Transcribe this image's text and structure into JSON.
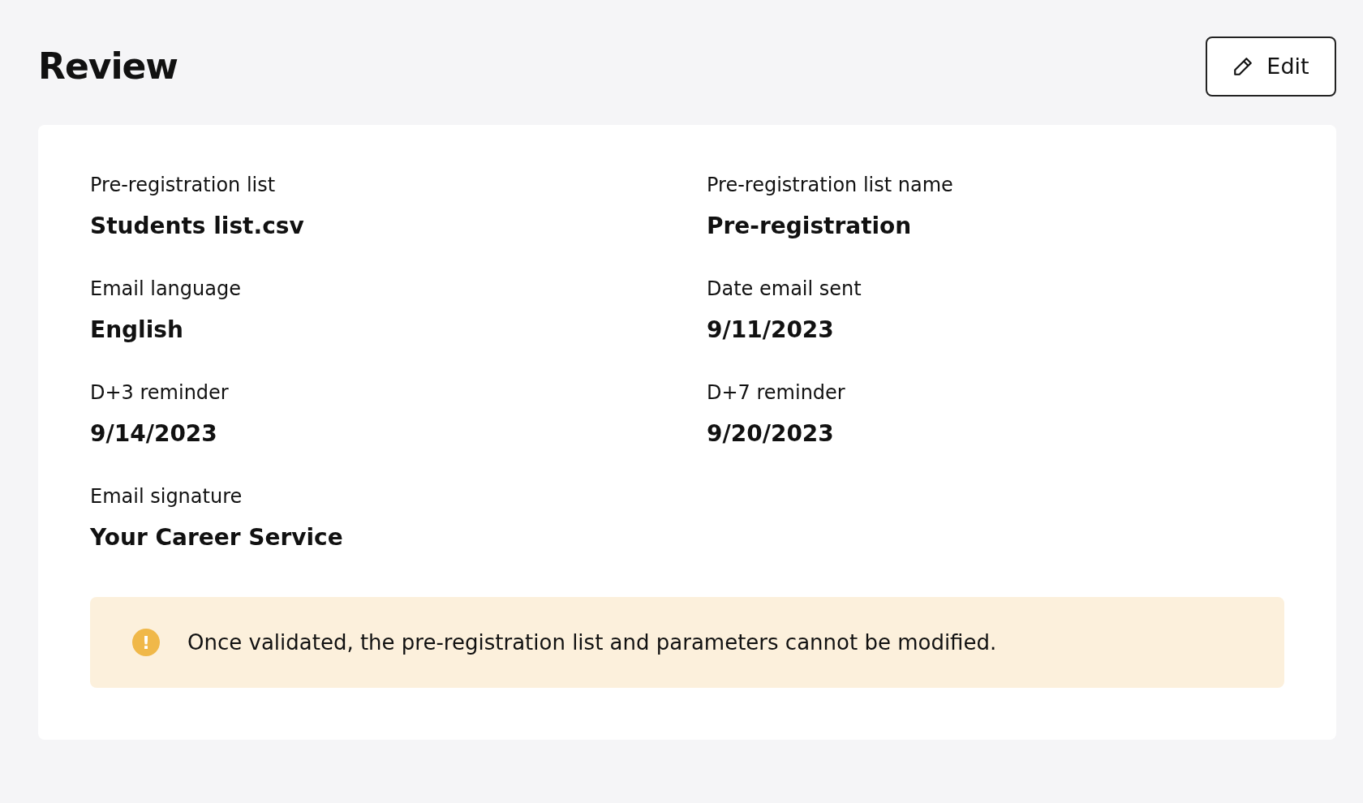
{
  "header": {
    "title": "Review",
    "edit_button": "Edit"
  },
  "fields": [
    {
      "label": "Pre-registration list",
      "value": "Students list.csv"
    },
    {
      "label": "Pre-registration list name",
      "value": "Pre-registration"
    },
    {
      "label": "Email language",
      "value": "English"
    },
    {
      "label": "Date email sent",
      "value": "9/11/2023"
    },
    {
      "label": "D+3 reminder",
      "value": "9/14/2023"
    },
    {
      "label": "D+7 reminder",
      "value": "9/20/2023"
    },
    {
      "label": "Email signature",
      "value": "Your Career Service"
    }
  ],
  "warning": {
    "icon": "!",
    "text": "Once validated, the pre-registration list and parameters cannot be modified."
  }
}
